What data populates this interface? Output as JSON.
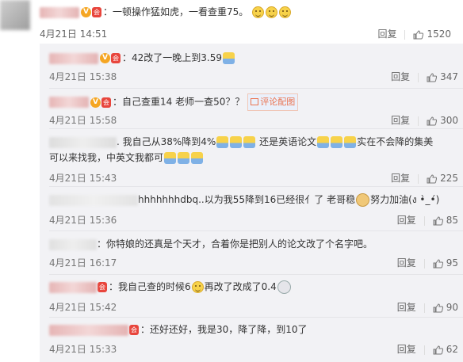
{
  "main_comment": {
    "text": "：一顿操作猛如虎，一看查重75。",
    "date": "4月21日 14:51",
    "reply_label": "回复",
    "likes": "1520"
  },
  "replies": [
    {
      "text": "42改了一晚上到3.59",
      "date": "4月21日 15:38",
      "reply_label": "回复",
      "likes": "347"
    },
    {
      "text": "自己查重14 老师一查50？？",
      "link_label": "评论配图",
      "date": "4月21日 15:58",
      "reply_label": "回复",
      "likes": "300"
    },
    {
      "text_a": ". 我自己从38%降到4%",
      "text_b": "还是英语论文",
      "text_c": "实在不会降的集美",
      "text_d": "可以来找我，中英文我都可",
      "date": "4月21日 15:43",
      "reply_label": "回复",
      "likes": "225"
    },
    {
      "text_a": "hhhhhhhdbq..以为我55降到16已经很亻了 老哥稳",
      "text_b": "努力加油(ง •̀_•́)",
      "date": "4月21日 15:36",
      "reply_label": "回复",
      "likes": "85"
    },
    {
      "text": "：你特娘的还真是个天才，合着你是把别人的论文改了个名字吧。",
      "date": "4月21日 16:17",
      "reply_label": "回复",
      "likes": "95"
    },
    {
      "text_a": "我自己查的时候6",
      "text_b": "再改了改成了0.4",
      "date": "4月21日 15:42",
      "reply_label": "回复",
      "likes": "90"
    },
    {
      "text": "：还好还好，我是30，降了降，到10了",
      "date": "4月21日 15:33",
      "reply_label": "回复",
      "likes": "62"
    }
  ],
  "colors": {
    "background": "#ffffff",
    "reply_panel": "#f2f2f5",
    "link": "#eb7350",
    "meta": "#777777"
  }
}
